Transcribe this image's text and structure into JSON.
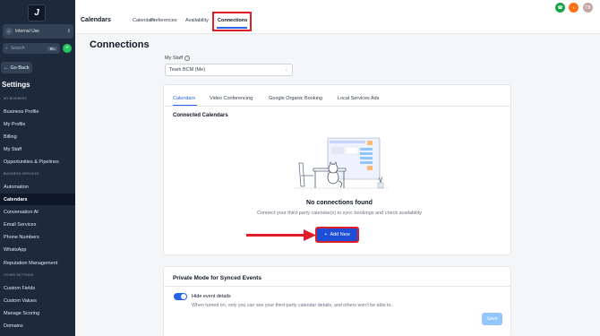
{
  "sidebar": {
    "logo_text": "J",
    "location": {
      "name": "Internal Use"
    },
    "search": {
      "placeholder": "Search",
      "shortcut": "⌘K"
    },
    "go_back": "Go Back",
    "settings_title": "Settings",
    "sections": [
      {
        "header": "MY BUSINESS"
      },
      {
        "header": "BUSINESS SERVICES"
      },
      {
        "header": "OTHER SETTINGS"
      }
    ],
    "items": [
      {
        "label": "Business Profile"
      },
      {
        "label": "My Profile"
      },
      {
        "label": "Billing"
      },
      {
        "label": "My Staff"
      },
      {
        "label": "Opportunities & Pipelines"
      },
      {
        "label": "Automation"
      },
      {
        "label": "Calendars",
        "active": true
      },
      {
        "label": "Conversation AI"
      },
      {
        "label": "Email Services"
      },
      {
        "label": "Phone Numbers"
      },
      {
        "label": "WhatsApp"
      },
      {
        "label": "Reputation Management"
      },
      {
        "label": "Custom Fields"
      },
      {
        "label": "Custom Values"
      },
      {
        "label": "Manage Scoring"
      },
      {
        "label": "Domains"
      }
    ]
  },
  "header": {
    "title": "Calendars",
    "tabs": [
      {
        "label": "Calendars"
      },
      {
        "label": "Preferences"
      },
      {
        "label": "Availability"
      },
      {
        "label": "Connections",
        "active": true
      }
    ],
    "avatar_initials": "TB",
    "colors": {
      "phone": "#16a34a",
      "bell": "#f97316",
      "avatar": "#c4a5a5"
    }
  },
  "main": {
    "title": "Connections",
    "staff_label": "My Staff",
    "staff_value": "Team BCM (Me)",
    "card_tabs": [
      {
        "label": "Calendars",
        "active": true
      },
      {
        "label": "Video Conferencing"
      },
      {
        "label": "Google Organic Booking"
      },
      {
        "label": "Local Services Ads"
      }
    ],
    "connected_title": "Connected Calendars",
    "empty_title": "No connections found",
    "empty_desc": "Connect your third-party calendar(s) to sync bookings and check availability",
    "add_new": "Add New",
    "private_mode": {
      "title": "Private Mode for Synced Events",
      "toggle_label": "Hide event details",
      "toggle_on": true,
      "desc": "When turned on, only you can see your third-party calendar details, and others won't be able to.",
      "save": "Save"
    }
  },
  "colors": {
    "accent": "#2563eb",
    "highlight": "#e11d2a",
    "sidebar": "#1e293b"
  }
}
